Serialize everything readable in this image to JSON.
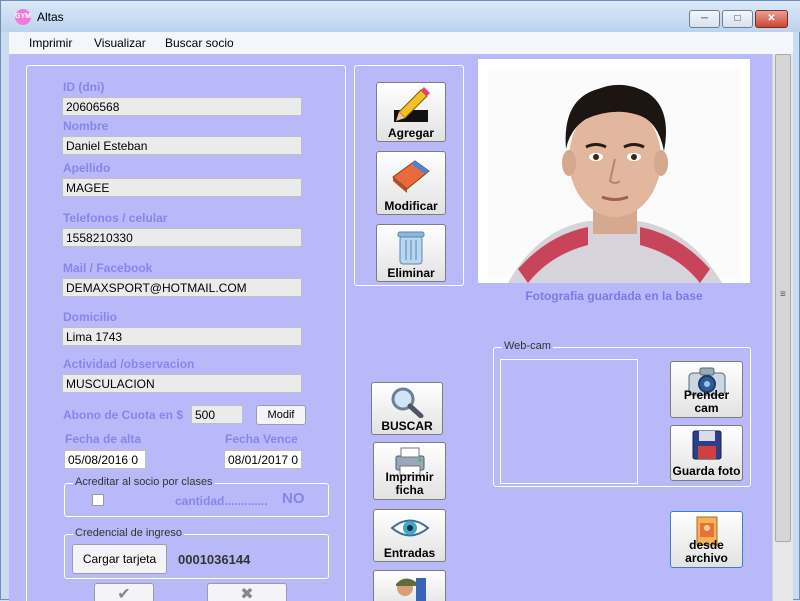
{
  "window": {
    "title": "Altas",
    "app_icon_text": "GYM"
  },
  "menu": {
    "items": [
      "Imprimir",
      "Visualizar",
      "Buscar socio"
    ]
  },
  "form": {
    "id_label": "ID (dni)",
    "id_value": "20606568",
    "nombre_label": "Nombre",
    "nombre_value": "Daniel Esteban",
    "apellido_label": "Apellido",
    "apellido_value": "MAGEE",
    "telefonos_label": "Telefonos / celular",
    "telefonos_value": "1558210330",
    "mail_label": "Mail / Facebook",
    "mail_value": "DEMAXSPORT@HOTMAIL.COM",
    "domicilio_label": "Domicilio",
    "domicilio_value": "Lima 1743",
    "actividad_label": "Actividad /observacion",
    "actividad_value": "MUSCULACION",
    "abono_label": "Abono de  Cuota en $",
    "abono_value": "500",
    "modif_label": "Modif",
    "fecha_alta_label": "Fecha de alta",
    "fecha_alta_value": "05/08/2016 0",
    "fecha_vence_label": "Fecha Vence",
    "fecha_vence_value": "08/01/2017 0"
  },
  "clases": {
    "title": "Acreditar al socio por clases",
    "cantidad_label": "cantidad.............",
    "cantidad_value": "NO"
  },
  "credencial": {
    "title": "Credencial de ingreso",
    "button": "Cargar tarjeta",
    "value": "0001036144"
  },
  "actions": {
    "agregar": "Agregar",
    "modificar": "Modificar",
    "eliminar": "Eliminar"
  },
  "tools": {
    "buscar": "BUSCAR",
    "imprimir": "Imprimir ficha",
    "entradas": "Entradas"
  },
  "photo": {
    "caption": "Fotografia guardada en la base"
  },
  "webcam": {
    "title": "Web-cam",
    "prender": "Prender cam",
    "guarda": "Guarda foto",
    "archivo": "desde archivo"
  },
  "colors": {
    "client_bg": "#b9b9f9",
    "label": "#8686e9",
    "accent": "#7a7ae8"
  }
}
